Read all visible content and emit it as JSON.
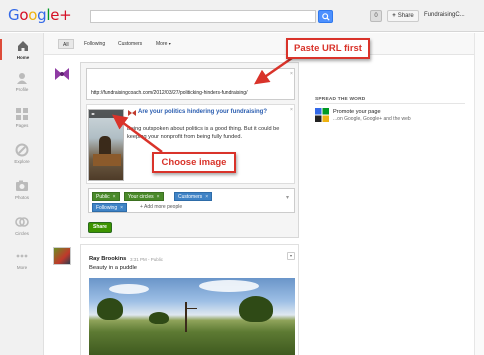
{
  "topbar": {
    "logo": {
      "g": "G",
      "o1": "o",
      "o2": "o",
      "g2": "g",
      "l": "l",
      "e": "e",
      "plus": "+"
    },
    "notifications_count": "0",
    "share_label": "Share",
    "share_plus": "+",
    "account_name": "FundraisingC..."
  },
  "leftnav": {
    "items": [
      {
        "label": "Home",
        "icon": "home-icon"
      },
      {
        "label": "Profile",
        "icon": "profile-icon"
      },
      {
        "label": "Pages",
        "icon": "pages-icon"
      },
      {
        "label": "Explore",
        "icon": "explore-icon"
      },
      {
        "label": "Photos",
        "icon": "photos-icon"
      },
      {
        "label": "Circles",
        "icon": "circles-icon"
      },
      {
        "label": "More",
        "icon": "more-icon"
      }
    ]
  },
  "stream": {
    "tabs": [
      {
        "label": "All"
      },
      {
        "label": "Following"
      },
      {
        "label": "Customers"
      },
      {
        "label": "More"
      }
    ]
  },
  "sharebox": {
    "url": "http://fundraisingcoach.com/2012/03/27/politicking-hinders-fundraising/",
    "thumb_nav": "◂▸",
    "link_title": "Are your politics hindering your fundraising?",
    "link_description": "Being outspoken about politics is a good thing. But it could be keeping your nonprofit from being fully funded.",
    "chips": [
      {
        "label": "Public",
        "color": "green"
      },
      {
        "label": "Your circles",
        "color": "green"
      },
      {
        "label": "Customers",
        "color": "blue"
      },
      {
        "label": "Following",
        "color": "blue"
      }
    ],
    "chip_close": "×",
    "add_people": "+ Add more people",
    "share_button": "Share"
  },
  "callouts": {
    "paste_url": "Paste URL first",
    "choose_image": "Choose image",
    "color": "#d9332a"
  },
  "rightcol": {
    "section_title": "SPREAD THE WORD",
    "promo_title": "Promote your page",
    "promo_sub": "...on Google, Google+ and the web"
  },
  "post": {
    "author": "Ray Brookins",
    "meta": "3:31 PM  -  Public",
    "text": "Beauty in a puddle"
  }
}
